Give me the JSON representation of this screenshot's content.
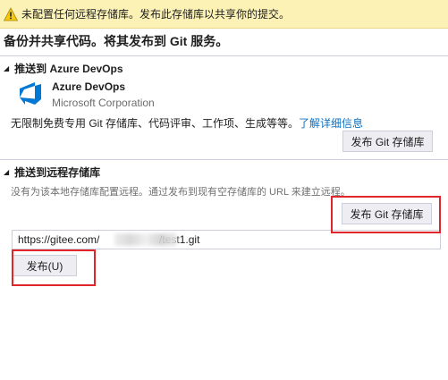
{
  "warning": {
    "icon": "warning-icon",
    "text": "未配置任何远程存储库。发布此存储库以共享你的提交。"
  },
  "title": "备份并共享代码。将其发布到 Git 服务。",
  "azure_section": {
    "header": "推送到 Azure DevOps",
    "provider_name": "Azure DevOps",
    "provider_company": "Microsoft Corporation",
    "description": "无限制免费专用 Git 存储库、代码评审、工作项、生成等等。",
    "learn_more": "了解详细信息",
    "publish_button": "发布 Git 存储库"
  },
  "remote_section": {
    "header": "推送到远程存储库",
    "description": "没有为该本地存储库配置远程。通过发布到现有空存储库的 URL 来建立远程。",
    "publish_button": "发布 Git 存储库",
    "url_value": "https://gitee.com/                    /test1.git",
    "publish_u_button": "发布(U)"
  },
  "colors": {
    "warning_bg": "#fcf2b6",
    "link": "#0e70c0",
    "highlight": "#e0262b",
    "azure_blue": "#0078d4"
  }
}
